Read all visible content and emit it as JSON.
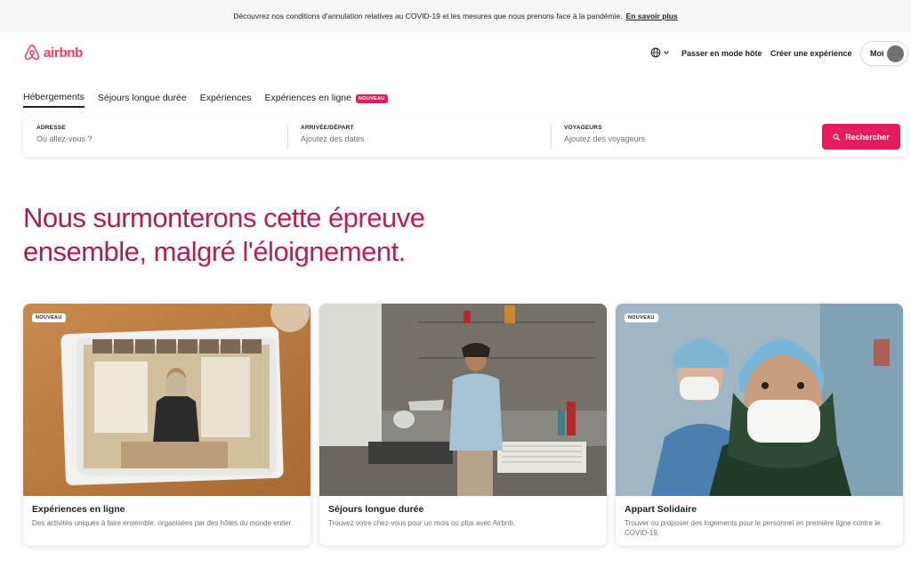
{
  "banner": {
    "text": "Découvrez nos conditions d'annulation relatives au COVID-19 et les mesures que nous prenons face à la pandémie.",
    "link": "En savoir plus"
  },
  "header": {
    "logo_text": "airbnb",
    "host_link": "Passer en mode hôte",
    "experience_link": "Créer une expérience",
    "profile_label": "Moi"
  },
  "tabs": [
    {
      "label": "Hébergements",
      "active": true
    },
    {
      "label": "Séjours longue durée"
    },
    {
      "label": "Expériences"
    },
    {
      "label": "Expériences en ligne",
      "badge": "NOUVEAU"
    }
  ],
  "search": {
    "address": {
      "label": "ADRESSE",
      "placeholder": "Où allez-vous ?"
    },
    "dates": {
      "label": "ARRIVÉE/DÉPART",
      "placeholder": "Ajoutez des dates"
    },
    "guests": {
      "label": "VOYAGEURS",
      "placeholder": "Ajoutez des voyageurs"
    },
    "button": "Rechercher"
  },
  "headline": {
    "line1": "Nous surmonterons cette épreuve",
    "line2": "ensemble, malgré l'éloignement."
  },
  "cards": [
    {
      "badge": "NOUVEAU",
      "title": "Expériences en ligne",
      "description": "Des activités uniques à faire ensemble, organisées par des hôtes du monde entier."
    },
    {
      "title": "Séjours longue durée",
      "description": "Trouvez votre chez-vous pour un mois ou plus avec Airbnb."
    },
    {
      "badge": "NOUVEAU",
      "title": "Appart Solidaire",
      "description": "Trouver ou proposer des logements pour le personnel en première ligne contre le COVID-19."
    }
  ],
  "colors": {
    "brand": "#FF385C",
    "search_button": "#E31C5F",
    "headline_start": "#A61D55",
    "headline_end": "#D70466"
  },
  "icons": {
    "logo": "airbnb-belo-icon",
    "language": "globe-icon",
    "dropdown": "chevron-down-icon",
    "search": "magnifier-icon",
    "profile": "avatar"
  }
}
